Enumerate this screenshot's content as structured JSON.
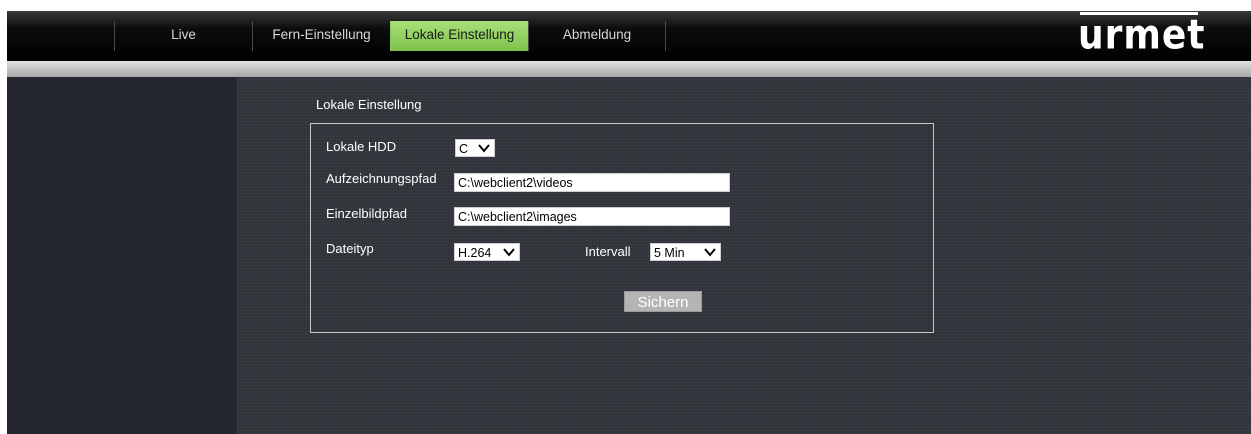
{
  "nav": {
    "items": [
      {
        "label": "Live"
      },
      {
        "label": "Fern-Einstellung"
      },
      {
        "label": "Lokale Einstellung"
      },
      {
        "label": "Abmeldung"
      }
    ],
    "active_index": 2
  },
  "brand": {
    "logo_text": "urmet"
  },
  "page": {
    "section_title": "Lokale Einstellung"
  },
  "form": {
    "local_hdd_label": "Lokale HDD",
    "local_hdd_value": "C",
    "record_path_label": "Aufzeichnungspfad",
    "record_path_value": "C:\\webclient2\\videos",
    "snapshot_path_label": "Einzelbildpfad",
    "snapshot_path_value": "C:\\webclient2\\images",
    "file_type_label": "Dateityp",
    "file_type_value": "H.264",
    "interval_label": "Intervall",
    "interval_value": "5 Min",
    "save_label": "Sichern"
  },
  "colors": {
    "active_tab": "#8fd05c",
    "background": "#30343a",
    "sidebar": "#24272e"
  }
}
